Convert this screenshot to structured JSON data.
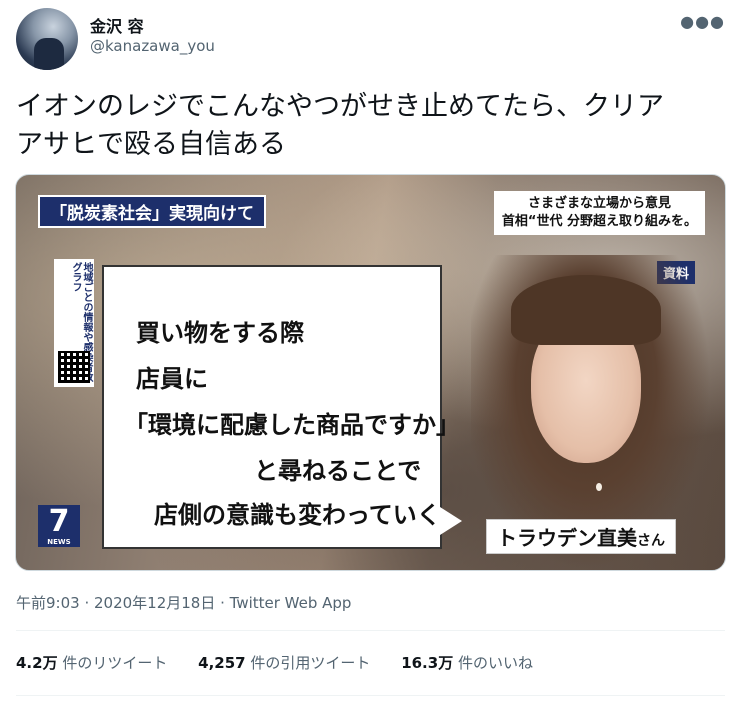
{
  "author": {
    "name": "金沢 容",
    "handle": "@kanazawa_you",
    "more_icon": "more-horizontal-icon"
  },
  "tweet": {
    "text_line1": "イオンのレジでこんなやつがせき止めてたら、クリア",
    "text_line2": "アサヒで殴る自信ある"
  },
  "media": {
    "caption_top": "「脱炭素社会」実現向けて",
    "news_box_line1": "さまざまな立場から意見",
    "news_box_line2": "首相“世代 分野超え取り組みを。",
    "shiryo": "資料",
    "side_text": "地域ごとの情報や感染者数グラフ",
    "bubble": {
      "line1": "買い物をする際",
      "line2": "店員に",
      "line3": "「環境に配慮した商品ですか」",
      "line4": "と尋ねることで",
      "line5": "店側の意識も変わっていく"
    },
    "nameplate": "トラウデン直美",
    "nameplate_suffix": "さん",
    "logo_number": "7",
    "logo_label": "NEWS"
  },
  "meta": "午前9:03 · 2020年12月18日 · Twitter Web App",
  "stats": {
    "retweets_count": "4.2万",
    "retweets_label": "件のリツイート",
    "quotes_count": "4,257",
    "quotes_label": "件の引用ツイート",
    "likes_count": "16.3万",
    "likes_label": "件のいいね"
  }
}
